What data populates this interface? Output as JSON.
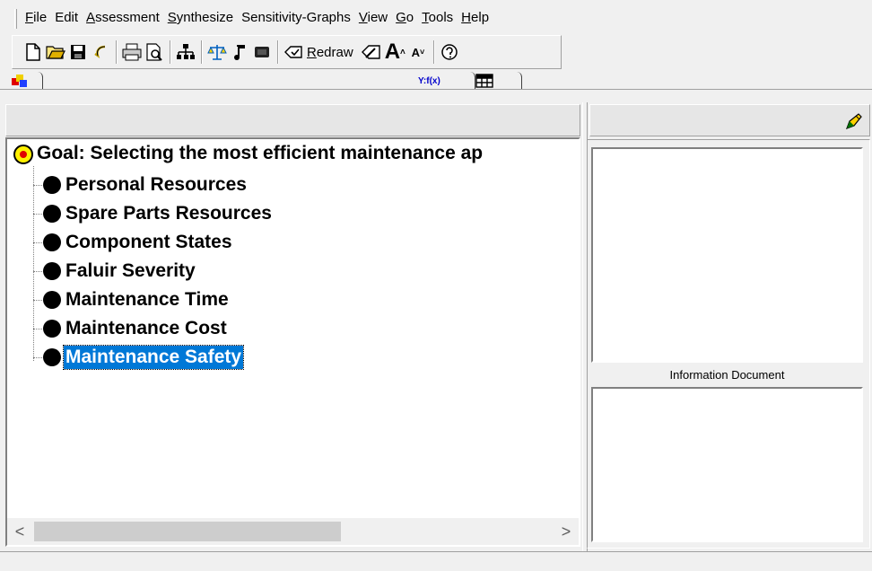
{
  "menu": [
    {
      "label": "File",
      "key": "F",
      "rest": "ile"
    },
    {
      "label": "Edit",
      "key": "",
      "rest": "Edit"
    },
    {
      "label": "Assessment",
      "key": "A",
      "rest": "ssessment"
    },
    {
      "label": "Synthesize",
      "key": "S",
      "rest": "ynthesize"
    },
    {
      "label": "Sensitivity-Graphs",
      "key": "",
      "rest": "Sensitivity-Graphs"
    },
    {
      "label": "View",
      "key": "V",
      "rest": "iew"
    },
    {
      "label": "Go",
      "key": "G",
      "rest": "o"
    },
    {
      "label": "Tools",
      "key": "T",
      "rest": "ools"
    },
    {
      "label": "Help",
      "key": "H",
      "rest": "elp"
    }
  ],
  "toolbar": {
    "redraw_key": "R",
    "redraw_rest": "edraw",
    "font_big": "A",
    "font_small": "A"
  },
  "tabs": {
    "yfx_label": "Y:f(x)"
  },
  "tree": {
    "goal": "Goal: Selecting the most efficient maintenance ap",
    "nodes": [
      {
        "label": "Personal Resources",
        "selected": false
      },
      {
        "label": "Spare Parts Resources",
        "selected": false
      },
      {
        "label": "Component States",
        "selected": false
      },
      {
        "label": "Faluir Severity",
        "selected": false
      },
      {
        "label": "Maintenance Time",
        "selected": false
      },
      {
        "label": "Maintenance Cost",
        "selected": false
      },
      {
        "label": "Maintenance Safety",
        "selected": true
      }
    ]
  },
  "right_panel": {
    "info_label": "Information Document"
  },
  "scroll": {
    "left_arrow": "<",
    "right_arrow": ">"
  },
  "colors": {
    "selection": "#0078d7",
    "goal_fill": "#fff000",
    "goal_center": "#e00000"
  }
}
